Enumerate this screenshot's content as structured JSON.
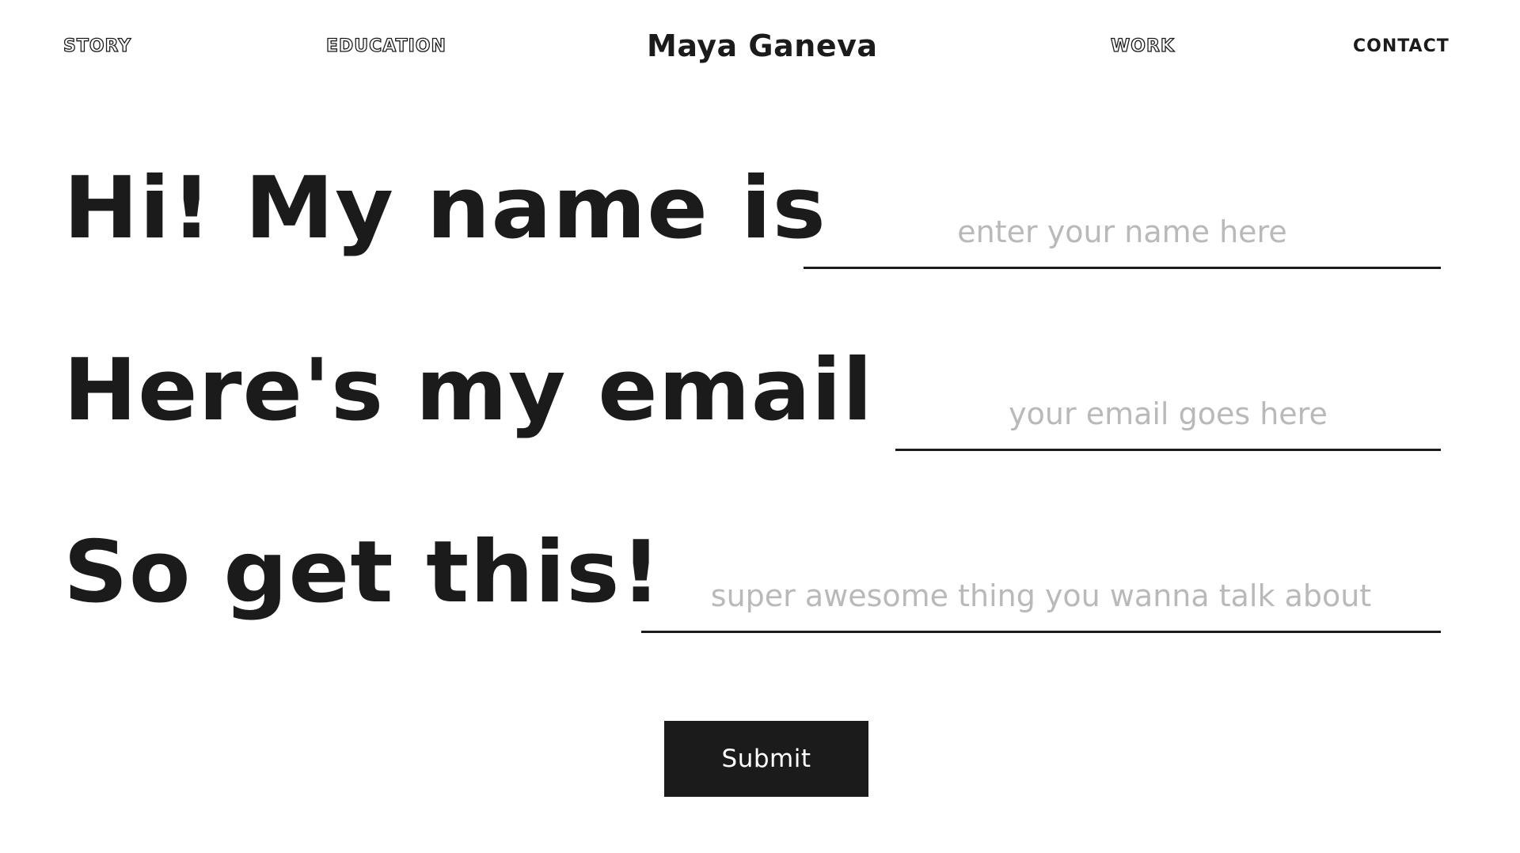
{
  "nav": {
    "story": "STORY",
    "education": "EDUCATION",
    "brand": "Maya Ganeva",
    "work": "WORK",
    "contact": "CONTACT",
    "active": "contact"
  },
  "form": {
    "name": {
      "label": "Hi! My name is",
      "value": "",
      "placeholder": "enter your name here"
    },
    "email": {
      "label": "Here's my email",
      "value": "",
      "placeholder": "your email goes here"
    },
    "topic": {
      "label": "So get this!",
      "value": "",
      "placeholder": "super awesome thing you wanna talk about"
    },
    "submit_label": "Submit"
  },
  "colors": {
    "ink": "#1b1b1b",
    "placeholder": "#b9b9b9",
    "background": "#ffffff",
    "button_text": "#ffffff"
  }
}
